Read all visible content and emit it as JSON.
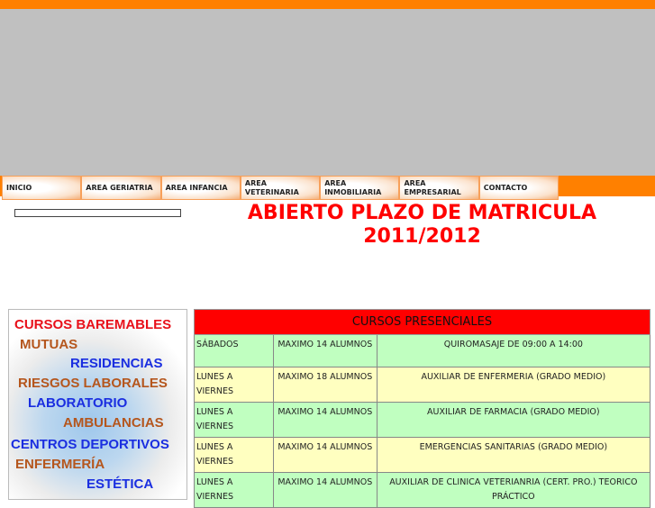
{
  "nav": [
    "INICIO",
    "AREA GERIATRIA",
    "AREA INFANCIA",
    "AREA VETERINARIA",
    "AREA INMOBILIARIA",
    "AREA EMPRESARIAL",
    "CONTACTO"
  ],
  "headline": {
    "line1": "ABIERTO PLAZO DE MATRICULA",
    "line2": "2011/2012"
  },
  "promo": [
    {
      "text": "CURSOS BAREMABLES",
      "color": "#e8101a"
    },
    {
      "text": "MUTUAS",
      "color": "#b5561d"
    },
    {
      "text": "RESIDENCIAS",
      "color": "#1a2ee0"
    },
    {
      "text": "RIESGOS LABORALES",
      "color": "#b5561d"
    },
    {
      "text": "LABORATORIO",
      "color": "#1a2ee0"
    },
    {
      "text": "AMBULANCIAS",
      "color": "#b5561d"
    },
    {
      "text": "CENTROS DEPORTIVOS",
      "color": "#1a2ee0"
    },
    {
      "text": "ENFERMERÍA",
      "color": "#b5561d"
    },
    {
      "text": "ESTÉTICA",
      "color": "#1a2ee0"
    }
  ],
  "table": {
    "header": "CURSOS PRESENCIALES",
    "rows": [
      [
        "SÁBADOS",
        "MAXIMO 14 ALUMNOS",
        "QUIROMASAJE DE 09:00 A 14:00"
      ],
      [
        "LUNES A VIERNES",
        "MAXIMO 18 ALUMNOS",
        "AUXILIAR DE ENFERMERIA (GRADO MEDIO)"
      ],
      [
        "LUNES A VIERNES",
        "MAXIMO 14 ALUMNOS",
        "AUXILIAR DE FARMACIA (GRADO MEDIO)"
      ],
      [
        "LUNES A VIERNES",
        "MAXIMO 14 ALUMNOS",
        "EMERGENCIAS SANITARIAS (GRADO MEDIO)"
      ],
      [
        "LUNES A VIERNES",
        "MAXIMO 14 ALUMNOS",
        "AUXILIAR DE CLINICA VETERIANRIA (CERT. PRO.) TEORICO PRÁCTICO"
      ]
    ]
  }
}
